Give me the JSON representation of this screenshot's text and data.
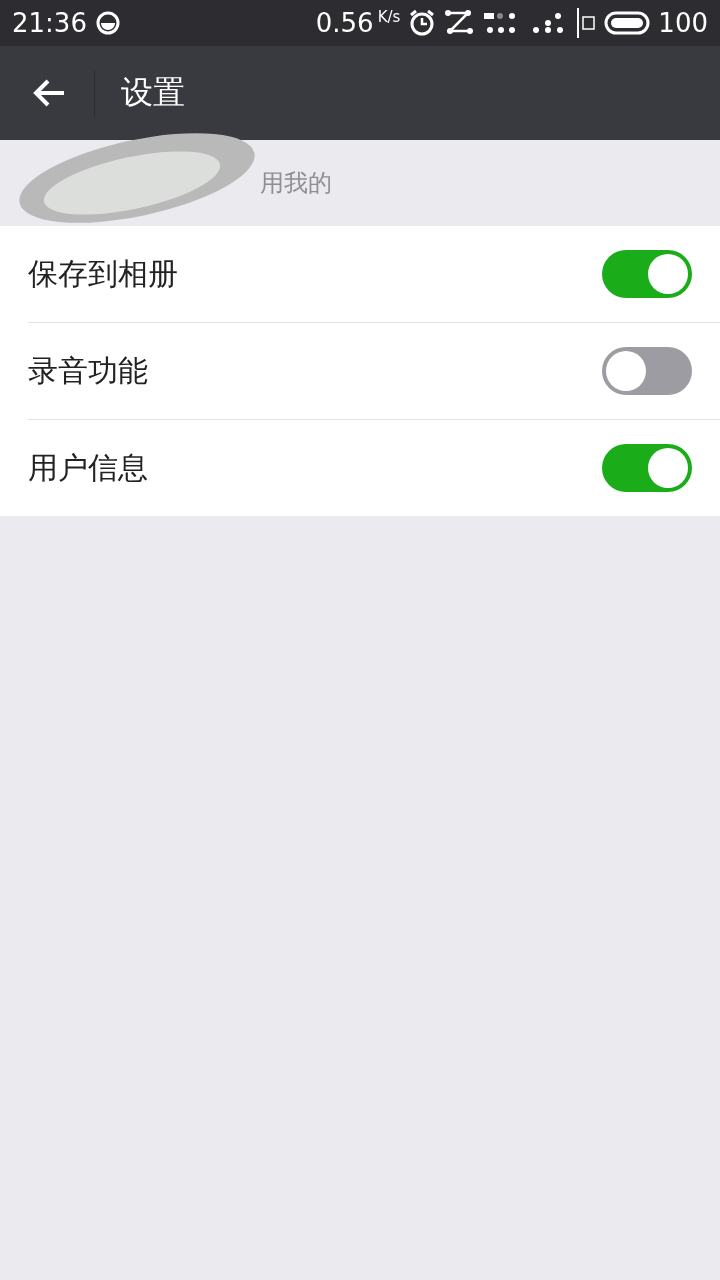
{
  "status_bar": {
    "time": "21:36",
    "speed": "0.56",
    "speed_unit": "K/s",
    "battery": "100"
  },
  "header": {
    "title": "设置"
  },
  "hint": "用我的",
  "settings": [
    {
      "label": "保存到相册",
      "on": true
    },
    {
      "label": "录音功能",
      "on": false
    },
    {
      "label": "用户信息",
      "on": true
    }
  ]
}
